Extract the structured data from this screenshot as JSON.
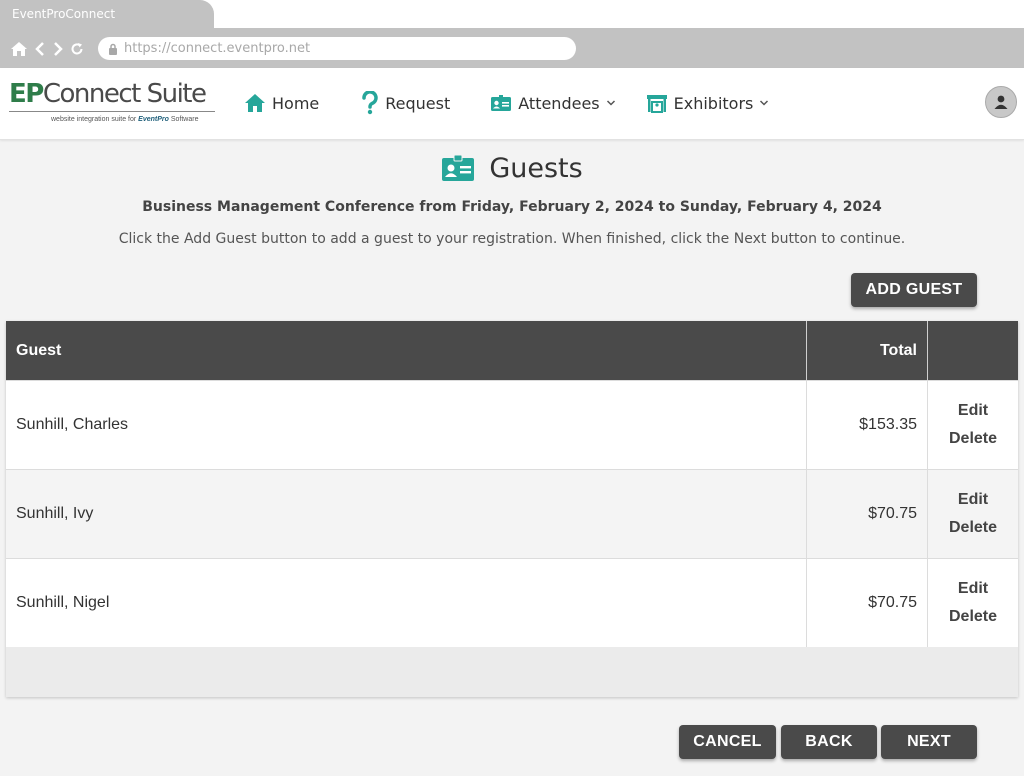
{
  "browser": {
    "tab_title": "EventProConnect",
    "url": "https://connect.eventpro.net"
  },
  "header": {
    "logo": {
      "ep": "EP",
      "connect_suite": "Connect Suite",
      "tagline": "website integration suite for",
      "brand": "EventPro",
      "brand_suffix": "Software"
    },
    "nav": [
      {
        "label": "Home",
        "icon": "home-icon"
      },
      {
        "label": "Request",
        "icon": "question-icon"
      },
      {
        "label": "Attendees",
        "icon": "badge-icon",
        "dropdown": true
      },
      {
        "label": "Exhibitors",
        "icon": "booth-icon",
        "dropdown": true
      }
    ],
    "user_icon": "user-icon"
  },
  "main": {
    "title": "Guests",
    "event_heading": "Business Management Conference from Friday, February 2, 2024 to Sunday, February 4, 2024",
    "instructions": "Click the Add Guest button to add a guest to your registration. When finished, click the Next button to continue.",
    "add_guest_label": "ADD GUEST",
    "table": {
      "columns": [
        "Guest",
        "Total",
        ""
      ],
      "rows": [
        {
          "guest": "Sunhill, Charles",
          "total": "$153.35",
          "edit": "Edit",
          "delete": "Delete"
        },
        {
          "guest": "Sunhill, Ivy",
          "total": "$70.75",
          "edit": "Edit",
          "delete": "Delete"
        },
        {
          "guest": "Sunhill, Nigel",
          "total": "$70.75",
          "edit": "Edit",
          "delete": "Delete"
        }
      ]
    }
  },
  "footer": {
    "cancel_label": "CANCEL",
    "back_label": "BACK",
    "next_label": "NEXT"
  },
  "colors": {
    "accent": "#26a69a",
    "dark_button": "#4a4a4a",
    "chrome": "#c2c2c2"
  }
}
